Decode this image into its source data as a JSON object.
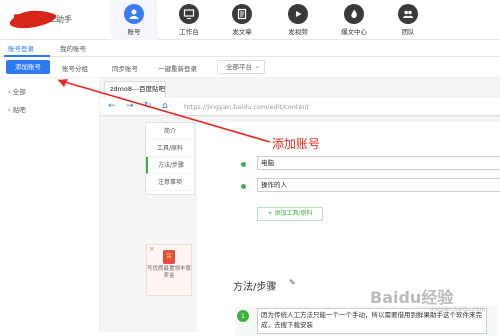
{
  "app": {
    "logo_text": "二助手"
  },
  "nav": [
    {
      "label": "账号",
      "icon": "user-icon",
      "active": true
    },
    {
      "label": "工作台",
      "icon": "desktop-icon"
    },
    {
      "label": "发文章",
      "icon": "article-icon"
    },
    {
      "label": "发视频",
      "icon": "video-icon"
    },
    {
      "label": "爆文中心",
      "icon": "hot-article-icon"
    },
    {
      "label": "团队",
      "icon": "team-icon"
    }
  ],
  "tabs": {
    "login": "账号登录",
    "mine": "我的账号"
  },
  "toolbar": {
    "add": "添加账号",
    "group": "账号分组",
    "sync": "同步账号",
    "relogin": "一键重新登录",
    "platform": "全部平台"
  },
  "sidebar": {
    "all": "全部",
    "tieba": "贴吧"
  },
  "browser": {
    "tab_title": "zdmo8---百度贴吧",
    "url": "https://jingyan.baidu.com/edit/content"
  },
  "editor": {
    "menu": [
      "简介",
      "工具/原料",
      "方法/步骤",
      "注意事项"
    ],
    "rows": [
      "电脑",
      "操作的人"
    ],
    "add_tool": "+ 添加工具/原料",
    "section": "方法/步骤",
    "step_num": "1",
    "step_text": "因为传统人工方法只能一个一个手动，所以需要借用到鲜果助手这个软件来完成，去搜下载安装",
    "ad_text": "写优质最置领丰厚奖金"
  },
  "annotation": "添加账号",
  "watermark": {
    "main": "Baidu经验",
    "sub": "jingyan.baidu.com"
  },
  "colors": {
    "accent": "#2d79f0",
    "green": "#3cb043",
    "annot": "#e8261c"
  }
}
